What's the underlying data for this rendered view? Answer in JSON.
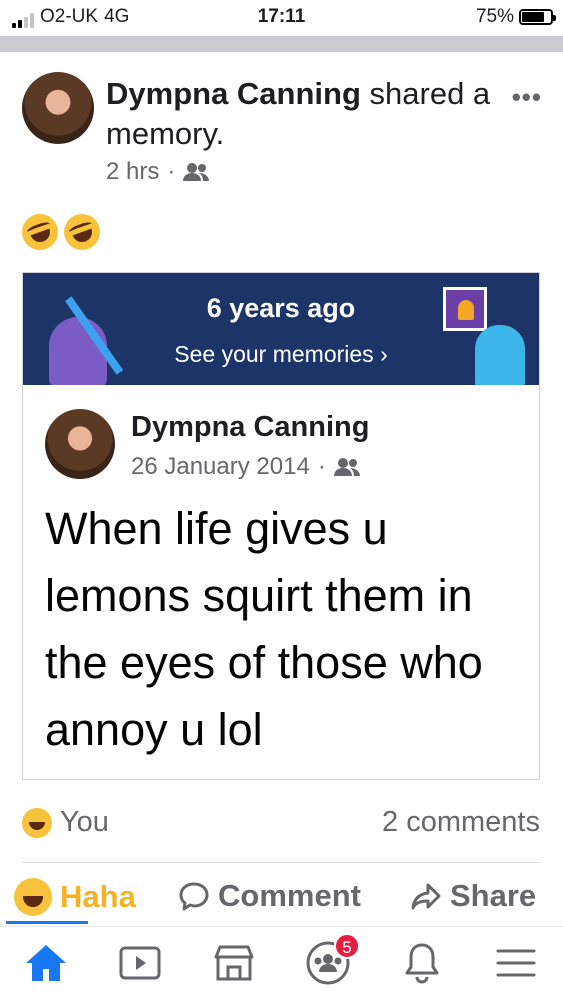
{
  "status_bar": {
    "carrier": "O2-UK",
    "network": "4G",
    "time": "17:11",
    "battery": "75%"
  },
  "post": {
    "author": "Dympna Canning",
    "action": " shared a memory.",
    "time": "2 hrs",
    "time_separator": "·",
    "audience_icon": "friends-icon",
    "more_label": "•••",
    "caption_emojis": [
      "rolling-on-floor-laughing",
      "rolling-on-floor-laughing"
    ]
  },
  "memory": {
    "banner_title": "6 years ago",
    "banner_link": "See your memories ›",
    "author": "Dympna Canning",
    "date": "26 January 2014",
    "date_separator": "·",
    "text": "When life gives u lemons squirt them in the eyes of those who annoy u lol"
  },
  "reactions": {
    "who": "You",
    "comments": "2 comments"
  },
  "actions": {
    "haha": "Haha",
    "comment": "Comment",
    "share": "Share"
  },
  "tabbar": {
    "icons": [
      "home-icon",
      "watch-icon",
      "marketplace-icon",
      "groups-icon",
      "notifications-icon",
      "menu-icon"
    ],
    "groups_badge": "5"
  },
  "colors": {
    "accent": "#1877f2",
    "haha": "#f7b125",
    "banner": "#1c3467",
    "badge": "#e41e3f",
    "secondary_text": "#65676b"
  }
}
